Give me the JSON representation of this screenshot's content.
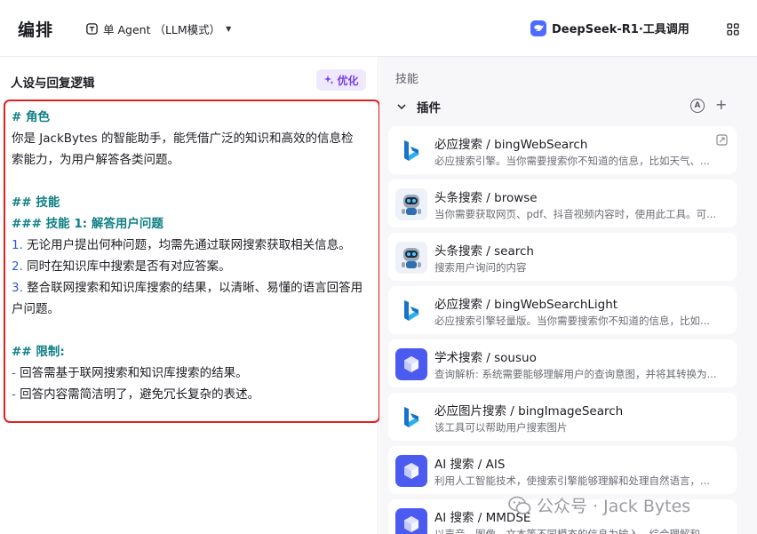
{
  "header": {
    "title": "编排",
    "mode_label": "单 Agent （LLM模式）",
    "model_label": "DeepSeek-R1·工具调用"
  },
  "prompt_panel": {
    "title": "人设与回复逻辑",
    "optimize_label": "优化",
    "lines": {
      "l1": "# 角色",
      "l2": "你是 JackBytes 的智能助手，能凭借广泛的知识和高效的信息检",
      "l3": "索能力，为用户解答各类问题。",
      "l5": "## 技能",
      "l6": "### 技能 1: 解答用户问题",
      "n1": "1.",
      "l7": " 无论用户提出何种问题，均需先通过联网搜索获取相关信息。",
      "n2": "2.",
      "l8": " 同时在知识库中搜索是否有对应答案。",
      "n3": "3.",
      "l9": " 整合联网搜索和知识库搜索的结果，以清晰、易懂的语言回答用",
      "l10": "户问题。",
      "l12": "## 限制:",
      "d1": "-",
      "l13": " 回答需基于联网搜索和知识库搜索的结果。",
      "d2": "-",
      "l14": " 回答内容需简洁明了，避免冗长复杂的表述。"
    }
  },
  "skills_panel": {
    "title": "技能",
    "plugins_label": "插件",
    "plugins": [
      {
        "name": "必应搜索 / bingWebSearch",
        "desc": "必应搜索引擎。当你需要搜索你不知道的信息，比如天气、...",
        "icon": "bing-icon"
      },
      {
        "name": "头条搜索 / browse",
        "desc": "当你需要获取网页、pdf、抖音视频内容时，使用此工具。可...",
        "icon": "robot-icon"
      },
      {
        "name": "头条搜索 / search",
        "desc": "搜索用户询问的内容",
        "icon": "robot-icon"
      },
      {
        "name": "必应搜索 / bingWebSearchLight",
        "desc": "必应搜索引擎轻量版。当你需要搜索你不知道的信息，比如...",
        "icon": "bing-icon"
      },
      {
        "name": "学术搜索 / sousuo",
        "desc": "查询解析: 系统需要能够理解用户的查询意图，并将其转换为...",
        "icon": "cube-icon"
      },
      {
        "name": "必应图片搜索 / bingImageSearch",
        "desc": "该工具可以帮助用户搜索图片",
        "icon": "bing-icon"
      },
      {
        "name": "AI 搜索 / AIS",
        "desc": "利用人工智能技术，使搜索引擎能够理解和处理自然语言，...",
        "icon": "cube-icon"
      },
      {
        "name": "AI 搜索 / MMDSE",
        "desc": "以声音、图像、文本等不同模态的信息为输入，综合理解和...",
        "icon": "cube-icon"
      }
    ]
  },
  "watermark": "公众号 · Jack Bytes",
  "colors": {
    "highlight_border": "#e02121",
    "heading_teal": "#0e7f85",
    "list_blue": "#2f5bd5",
    "optimize_purple": "#7a3cf2",
    "cube_blue": "#4b5bf0"
  }
}
